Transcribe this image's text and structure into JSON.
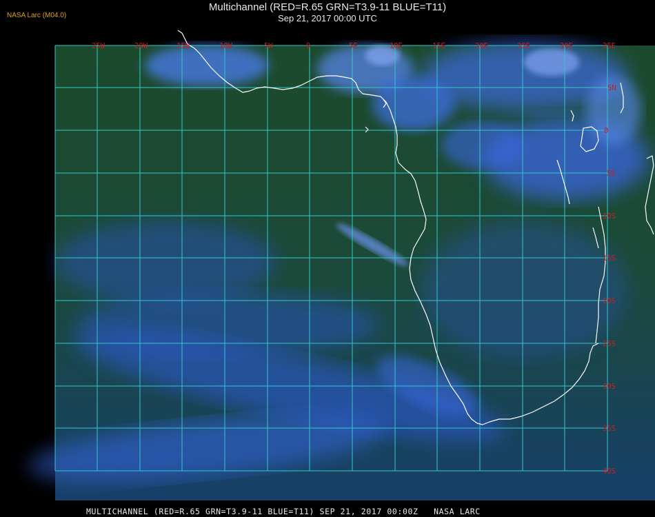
{
  "header": {
    "title": "Multichannel (RED=R.65 GRN=T3.9-11 BLUE=T11)",
    "subtitle": "Sep 21, 2017 00:00 UTC",
    "producer": "NASA Larc (M04.0)"
  },
  "footer": {
    "caption": "MULTICHANNEL (RED=R.65 GRN=T3.9-11 BLUE=T11) SEP 21, 2017 00:00Z   NASA LARC"
  },
  "grid": {
    "longitude_labels": [
      "25W",
      "20W",
      "15W",
      "10W",
      "5W",
      "0",
      "5E",
      "10E",
      "15E",
      "20E",
      "25E",
      "30E",
      "35E"
    ],
    "latitude_labels": [
      "5N",
      "0",
      "5S",
      "10S",
      "15S",
      "20S",
      "25S",
      "30S",
      "35S",
      "40S"
    ]
  },
  "colors": {
    "grid_line": "#33c8cc",
    "coastline": "#ffffff",
    "label": "#c8201f",
    "ocean_green": "#1b4d2a",
    "cloud_blue": "#2f5fe0",
    "bright_cloud": "#7fa8ff"
  }
}
